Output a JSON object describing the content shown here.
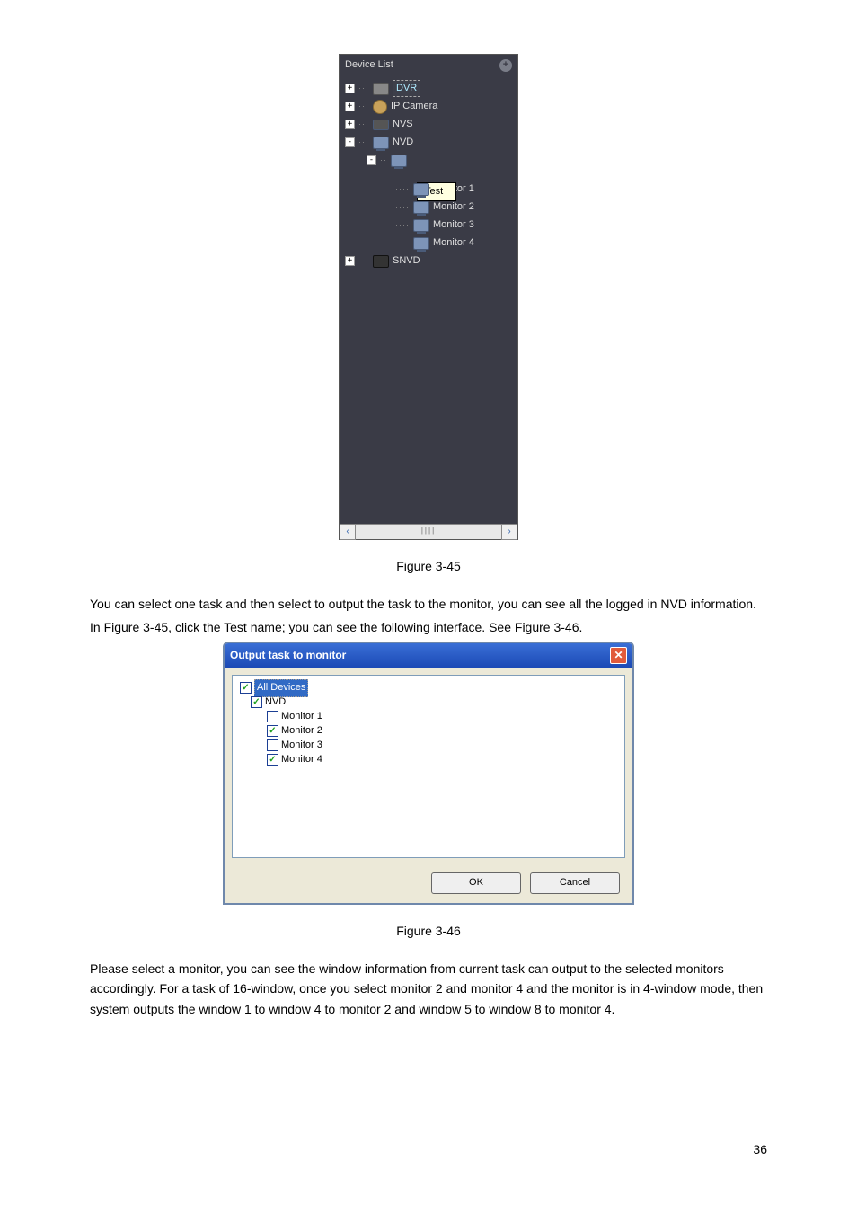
{
  "device_panel": {
    "title": "Device List",
    "tooltip": "Test",
    "items": {
      "dvr": "DVR",
      "ipc": "IP Camera",
      "nvs": "NVS",
      "nvd": "NVD",
      "mon1": "Monitor 1",
      "mon2": "Monitor 2",
      "mon3": "Monitor 3",
      "mon4": "Monitor 4",
      "snvd": "SNVD"
    }
  },
  "fig45_caption": "Figure 3-45",
  "para1": "You can select one task and then select to output the task to the monitor, you can see all the logged in NVD information.",
  "para2": "In Figure 3-45, click the Test name; you can see the following interface. See Figure 3-46.",
  "dialog": {
    "title": "Output task to monitor",
    "items": {
      "all": "All Devices",
      "nvd": "NVD",
      "m1": "Monitor 1",
      "m2": "Monitor 2",
      "m3": "Monitor 3",
      "m4": "Monitor 4"
    },
    "ok": "OK",
    "cancel": "Cancel"
  },
  "fig46_caption": "Figure 3-46",
  "para3": "Please select a monitor, you can see the window information from current task can output to the selected monitors accordingly. For a task of 16-window, once you select monitor 2 and monitor 4 and the monitor is in 4-window mode, then system outputs the window 1 to window 4 to monitor 2 and window 5 to window 8 to monitor 4.",
  "page_number": "36"
}
